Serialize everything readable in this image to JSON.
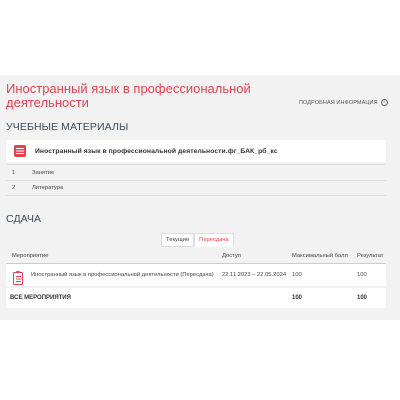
{
  "page": {
    "title": "Иностранный язык в профессиональной деятельности",
    "info_link": "ПОДРОБНАЯ ИНФОРМАЦИЯ",
    "info_icon": "i"
  },
  "materials": {
    "heading": "УЧЕБНЫЕ МАТЕРИАЛЫ",
    "course_label": "Иностранный язык в профессиональной деятельности.фг_БАК_рб_кс",
    "items": [
      {
        "num": "1",
        "label": "Занятие"
      },
      {
        "num": "2",
        "label": "Литература"
      }
    ]
  },
  "submission": {
    "heading": "СДАЧА",
    "tabs": [
      {
        "label": "Текущие"
      },
      {
        "label": "Пересдача"
      }
    ],
    "active_tab": "Пересдача",
    "columns": {
      "event": "Мероприятие",
      "access": "Доступ",
      "max_score": "Максимальный балл",
      "result": "Результат"
    },
    "rows": [
      {
        "event": "Иностранный язык в профессиональной деятельности (Пересдача)",
        "access": "22.11.2023 – 22.05.2024",
        "max_score": "100",
        "result": "100"
      }
    ],
    "total": {
      "label": "ВСЕ МЕРОПРИЯТИЯ",
      "max_score": "100",
      "result": "100"
    }
  },
  "colors": {
    "accent": "#e8404f",
    "heading": "#3d4a5a",
    "background": "#f2f2f2"
  }
}
